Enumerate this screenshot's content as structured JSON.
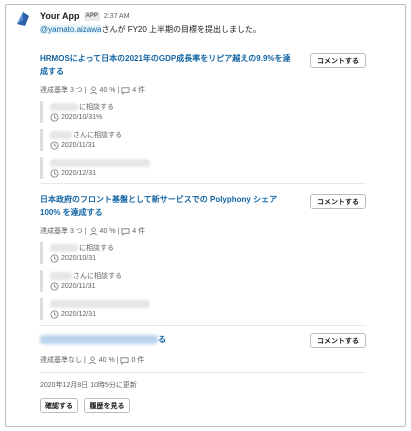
{
  "message": {
    "app_name": "Your App",
    "app_badge": "APP",
    "time": "2:37 AM",
    "mention": "@yamato.aizawa",
    "text": "さんが FY20 上半期の目標を提出しました。"
  },
  "goals": [
    {
      "title": "HRMOSによって日本の2021年のGDP成長率をリピア越えの9.9%を達成する",
      "comment_label": "コメントする",
      "meta_criteria": "達成基準 3 つ |",
      "meta_progress": "40 % |",
      "meta_count": "4 件",
      "items": [
        {
          "text": "に相談する",
          "date": "2020/10/31%"
        },
        {
          "text": "さんに相談する",
          "date": "2020/11/31"
        },
        {
          "text": "",
          "date": "2020/12/31"
        }
      ]
    },
    {
      "title": "日本政府のフロント基盤として新サービスでの Polyphony シェア 100% を達成する",
      "comment_label": "コメントする",
      "meta_criteria": "達成基準 3 つ |",
      "meta_progress": "40 % |",
      "meta_count": "4 件",
      "items": [
        {
          "text": "に相談する",
          "date": "2020/10/31"
        },
        {
          "text": "さんに相談する",
          "date": "2020/11/31"
        },
        {
          "text": "",
          "date": "2020/12/31"
        }
      ]
    },
    {
      "title_suffix": "る",
      "comment_label": "コメントする",
      "meta_criteria": "達成基準なし |",
      "meta_progress": "40 % |",
      "meta_count": "0 件"
    }
  ],
  "footer": {
    "updated": "2020年12月8日 10時5分に更新",
    "confirm_label": "確認する",
    "history_label": "履歴を見る"
  },
  "colors": {
    "link": "#1264a3",
    "mention_bg": "#e8f5fa",
    "quote_bar": "#dddddd"
  },
  "icons": [
    "app-logo-icon",
    "progress-person-icon",
    "comment-bubble-icon",
    "clock-icon"
  ]
}
